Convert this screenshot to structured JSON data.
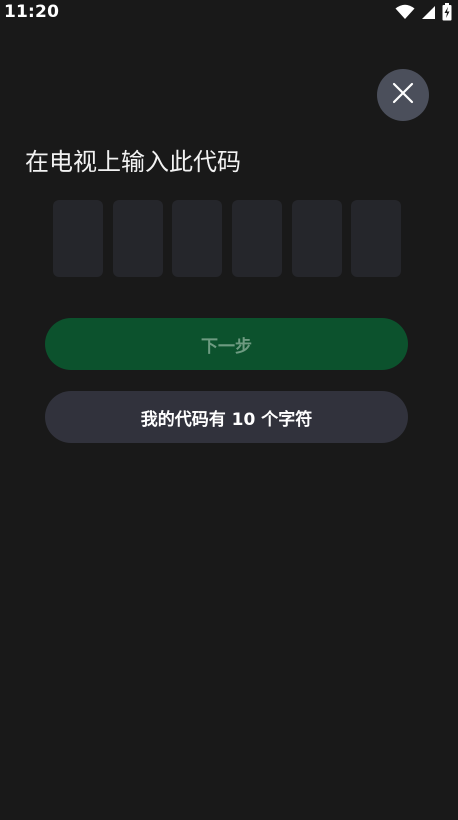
{
  "status_bar": {
    "time": "11:20",
    "icons": [
      "wifi-icon",
      "cellular-signal-icon",
      "battery-charging-icon"
    ]
  },
  "dialog": {
    "close_icon": "close-icon",
    "title": "在电视上输入此代码",
    "code_slots": [
      "",
      "",
      "",
      "",
      "",
      ""
    ],
    "next_button_label": "下一步",
    "ten_char_button_label": "我的代码有 10 个字符"
  },
  "colors": {
    "background": "#191919",
    "code_box": "#25262b",
    "primary_button_bg": "#0c522d",
    "primary_button_text": "#6e9b81",
    "secondary_button_bg": "#31323c",
    "close_button_bg": "#4b4f5b"
  }
}
